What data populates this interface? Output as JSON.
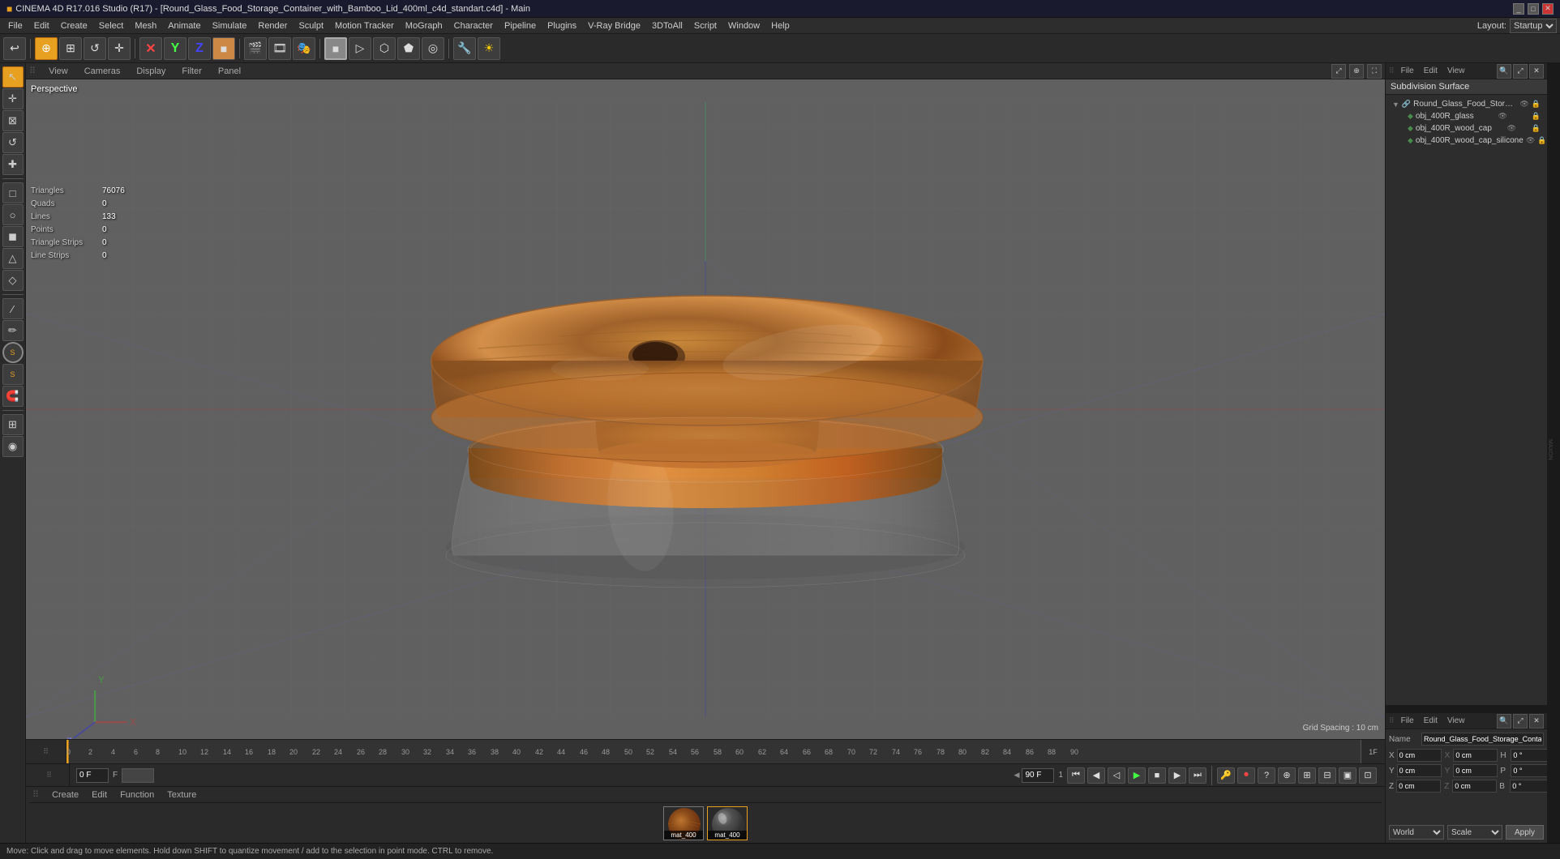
{
  "app": {
    "title": "CINEMA 4D R17.016 Studio (R17) - [Round_Glass_Food_Storage_Container_with_Bamboo_Lid_400ml_c4d_standart.c4d] - Main",
    "layout": "Startup"
  },
  "menu": {
    "items": [
      "File",
      "Edit",
      "Create",
      "Select",
      "Mesh",
      "Animate",
      "Simulate",
      "Render",
      "Sculpt",
      "Motion Tracker",
      "MoGraph",
      "Character",
      "Pipeline",
      "Plugins",
      "V-Ray Bridge",
      "3DToAll",
      "Script",
      "Window",
      "Help"
    ],
    "layout_label": "Layout:",
    "layout_value": "Startup"
  },
  "toolbar": {
    "move_label": "⊕",
    "rotate_label": "↺",
    "scale_label": "⊞",
    "render_label": "▶"
  },
  "viewport": {
    "perspective_label": "Perspective",
    "tabs": [
      "View",
      "Cameras",
      "Display",
      "Filter",
      "Panel"
    ],
    "grid_spacing": "Grid Spacing : 10 cm",
    "stats": {
      "triangles_label": "Triangles",
      "triangles_value": "76076",
      "quads_label": "Quads",
      "quads_value": "0",
      "lines_label": "Lines",
      "lines_value": "133",
      "points_label": "Points",
      "points_value": "0",
      "triangle_strips_label": "Triangle Strips",
      "triangle_strips_value": "0",
      "line_strips_label": "Line Strips",
      "line_strips_value": "0"
    }
  },
  "timeline": {
    "current_frame": "0 F",
    "frame_input": "0 F",
    "end_frame": "90 F",
    "fps": "1",
    "ticks": [
      "0",
      "2",
      "4",
      "6",
      "8",
      "10",
      "12",
      "14",
      "16",
      "18",
      "20",
      "22",
      "24",
      "26",
      "28",
      "30",
      "32",
      "34",
      "36",
      "38",
      "40",
      "42",
      "44",
      "46",
      "48",
      "50",
      "52",
      "54",
      "56",
      "58",
      "60",
      "62",
      "64",
      "66",
      "68",
      "70",
      "72",
      "74",
      "76",
      "78",
      "80",
      "82",
      "84",
      "86",
      "88",
      "90",
      "1F"
    ]
  },
  "material_bar": {
    "tabs": [
      "Create",
      "Edit",
      "Function",
      "Texture"
    ],
    "materials": [
      {
        "name": "mat_400",
        "selected": false
      },
      {
        "name": "mat_400",
        "selected": true
      }
    ]
  },
  "right_panel": {
    "top_tabs": [
      "File",
      "Edit",
      "View"
    ],
    "subdivision_surface": "Subdivision Surface",
    "scene_name": "Round_Glass_Food_Storage_Conta...",
    "objects": [
      {
        "name": "obj_400R_glass",
        "level": 1
      },
      {
        "name": "obj_400R_wood_cap",
        "level": 1
      },
      {
        "name": "obj_400R_wood_cap_silicone",
        "level": 1
      }
    ],
    "bottom_tabs": [
      "File",
      "Edit",
      "View"
    ],
    "name_label": "Name",
    "name_value": "Round_Glass_Food_Storage_Conta..."
  },
  "coords": {
    "x_pos": "0 cm",
    "y_pos": "0 cm",
    "z_pos": "0 cm",
    "x_size": "0 cm",
    "y_size": "0 cm",
    "z_size": "0 cm",
    "x_rot": "0 °",
    "y_rot": "0 °",
    "z_rot": "0 °",
    "h": "0 °",
    "p": "0 °",
    "b": "0 °",
    "world_label": "World",
    "scale_label": "Scale",
    "apply_label": "Apply"
  },
  "status_bar": {
    "message": "Move: Click and drag to move elements. Hold down SHIFT to quantize movement / add to the selection in point mode. CTRL to remove."
  },
  "colors": {
    "accent_orange": "#e8a020",
    "bg_dark": "#2a2a2a",
    "bg_mid": "#3a3a3a",
    "bg_viewport": "#606060",
    "grid_line": "#555555",
    "selected_blue": "#3a5a8a",
    "text_light": "#cccccc",
    "text_dim": "#888888"
  }
}
